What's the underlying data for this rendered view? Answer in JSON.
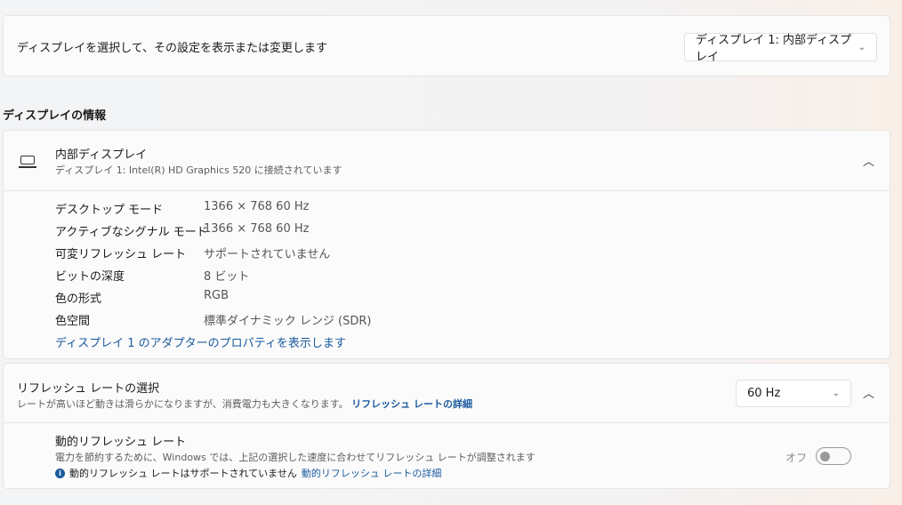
{
  "top": {
    "label": "ディスプレイを選択して、その設定を表示または変更します",
    "display_select": "ディスプレイ 1: 内部ディスプレイ"
  },
  "section_heading": "ディスプレイの情報",
  "display_info": {
    "title": "内部ディスプレイ",
    "subtitle": "ディスプレイ 1: Intel(R) HD Graphics 520 に接続されています",
    "rows": [
      {
        "label": "デスクトップ モード",
        "value": "1366 × 768 60 Hz"
      },
      {
        "label": "アクティブなシグナル モード",
        "value": "1366 × 768 60 Hz"
      },
      {
        "label": "可変リフレッシュ レート",
        "value": "サポートされていません"
      },
      {
        "label": "ビットの深度",
        "value": "8 ビット"
      },
      {
        "label": "色の形式",
        "value": "RGB"
      },
      {
        "label": "色空間",
        "value": "標準ダイナミック レンジ (SDR)"
      }
    ],
    "adapter_link": "ディスプレイ 1 のアダプターのプロパティを表示します"
  },
  "refresh": {
    "title": "リフレッシュ レートの選択",
    "desc": "レートが高いほど動きは滑らかになりますが、消費電力も大きくなります。",
    "link": "リフレッシュ レートの詳細",
    "value": "60 Hz",
    "dynamic": {
      "title": "動的リフレッシュ レート",
      "desc": "電力を節約するために、Windows では、上記の選択した速度に合わせてリフレッシュ レートが調整されます",
      "note": "動的リフレッシュ レートはサポートされていません",
      "link": "動的リフレッシュ レートの詳細",
      "toggle_label": "オフ",
      "toggle_on": false
    }
  }
}
